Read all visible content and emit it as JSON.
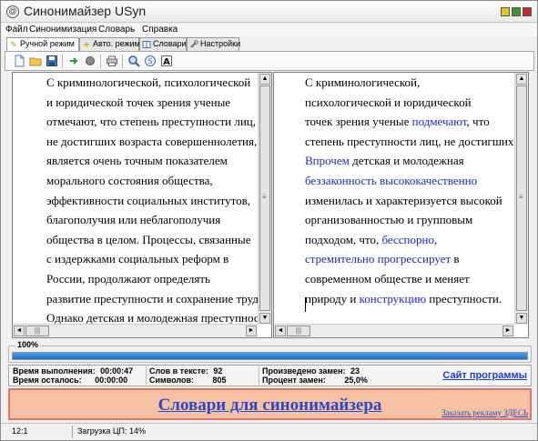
{
  "window": {
    "title": "Синонимайзер USyn",
    "app_icon_glyph": "@"
  },
  "menu": [
    "Файл",
    "Синонимизация",
    "Словарь",
    "Справка"
  ],
  "tabs": [
    {
      "label": "Ручной режим",
      "icon": "pencil-icon",
      "active": true
    },
    {
      "label": "Авто. режим",
      "icon": "star-icon",
      "active": false
    },
    {
      "label": "Словари",
      "icon": "book-icon",
      "active": false
    },
    {
      "label": "Настройки",
      "icon": "wrench-icon",
      "active": false
    }
  ],
  "toolbar": [
    "new-file-icon",
    "open-folder-icon",
    "save-icon",
    "arrow-right-icon",
    "record-icon",
    "print-icon",
    "synonym-search-icon",
    "replace-icon",
    "font-icon"
  ],
  "left_text": [
    "С криминологической, психологической",
    "и юридической точек зрения ученые",
    "отмечают, что степень преступности лиц,",
    "не достигших возраста совершеннолетия,",
    "является очень точным показателем",
    "морального состояния общества,",
    "эффективности социальных институтов,",
    "благополучия или неблагополучия",
    "общества в целом. Процессы, связанные",
    "с издержками социальных реформ в",
    "России, продолжают определять",
    "развитие преступности и сохранение трудностей",
    "Однако детская и молодежная преступность"
  ],
  "right_text": [
    [
      {
        "t": "С криминологической,"
      }
    ],
    [
      {
        "t": "психологической и юридической"
      }
    ],
    [
      {
        "t": "точек зрения ученые "
      },
      {
        "t": "подмечают",
        "h": true
      },
      {
        "t": ", что"
      }
    ],
    [
      {
        "t": "степень преступности лиц, не достигших"
      }
    ],
    [
      {
        "t": "Впрочем",
        "h": true
      },
      {
        "t": " детская и молодежная"
      }
    ],
    [
      {
        "t": "беззаконность высококачественно",
        "h": true
      }
    ],
    [
      {
        "t": "изменилась и характеризуется высокой"
      }
    ],
    [
      {
        "t": "организованностью и групповым"
      }
    ],
    [
      {
        "t": "подходом, что, "
      },
      {
        "t": "бесспорно",
        "h": true
      },
      {
        "t": ","
      }
    ],
    [
      {
        "t": "стремительно прогрессирует",
        "h": true
      },
      {
        "t": " в"
      }
    ],
    [
      {
        "t": "современном обществе и меняет"
      }
    ],
    [
      {
        "t": "природу и "
      },
      {
        "t": "конструкцию",
        "h": true
      },
      {
        "t": " преступности."
      }
    ]
  ],
  "progress": {
    "label": "100%",
    "value": 1.0
  },
  "stats": {
    "exec_time_label": "Время выполнения:",
    "exec_time": "00:00:47",
    "remain_label": "Время осталось:",
    "remain": "00:00:00",
    "words_label": "Слов в тексте:",
    "words": "92",
    "chars_label": "Символов:",
    "chars": "805",
    "repl_label": "Произведено замен:",
    "repl": "23",
    "pct_label": "Процент замен:",
    "pct": "25,0%"
  },
  "site_link": "Сайт программы",
  "banner": {
    "title": "Словари для синонимайзера",
    "ad": "Заказать рекламу ЗДЕСЬ"
  },
  "status": {
    "position": "12:1",
    "cpu": "Загрузка ЦП: 14%"
  },
  "colors": {
    "highlight": "#1f23d6",
    "link": "#1c3fd6",
    "banner_bg": "#f7c2a4",
    "banner_border": "#e07567",
    "progress": "#1d6fc9"
  }
}
